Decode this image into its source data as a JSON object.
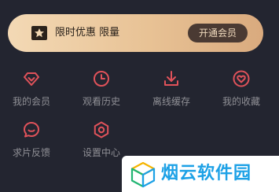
{
  "promo": {
    "text": "限时优惠 限量",
    "button_label": "开通会员",
    "icon": "star-badge-icon"
  },
  "menu": [
    {
      "label": "我的会员",
      "icon": "diamond-icon"
    },
    {
      "label": "观看历史",
      "icon": "clock-icon"
    },
    {
      "label": "离线缓存",
      "icon": "download-icon"
    },
    {
      "label": "我的收藏",
      "icon": "heart-icon"
    },
    {
      "label": "求片反馈",
      "icon": "feedback-icon"
    },
    {
      "label": "设置中心",
      "icon": "settings-icon"
    }
  ],
  "watermark": {
    "text": "烟云软件园"
  },
  "colors": {
    "background": "#232530",
    "accent": "#e0525a",
    "promo_gradient_start": "#f3d9b5",
    "promo_gradient_end": "#d9aa7e",
    "button_bg": "#4a3a33",
    "label": "#8f8f95",
    "watermark_text": "#1da1e6"
  }
}
